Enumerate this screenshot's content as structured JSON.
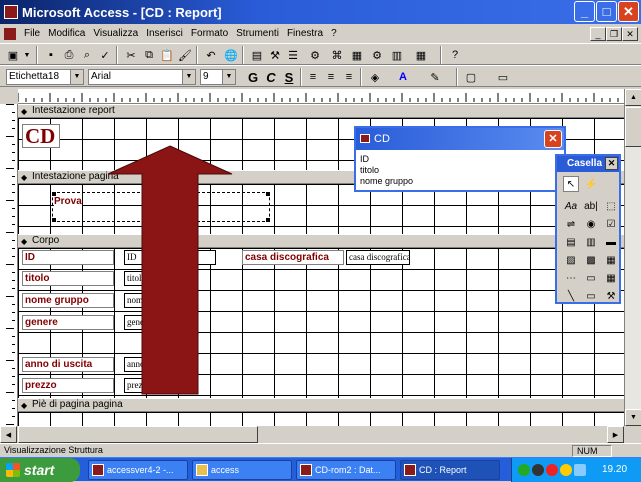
{
  "window": {
    "title": "Microsoft Access - [CD : Report]",
    "min": "_",
    "max": "□",
    "close": "✕"
  },
  "menu": {
    "items": [
      "File",
      "Modifica",
      "Visualizza",
      "Inserisci",
      "Formato",
      "Strumenti",
      "Finestra",
      "?"
    ]
  },
  "format_toolbar": {
    "object": "Etichetta18",
    "font": "Arial",
    "size": "9",
    "bold": "G",
    "italic": "C",
    "underline": "S"
  },
  "sections": {
    "report_header": "Intestazione report",
    "page_header": "Intestazione pagina",
    "detail": "Corpo",
    "page_footer": "Piè di pagina pagina"
  },
  "report_header": {
    "title": "CD"
  },
  "page_header": {
    "label": "Prova"
  },
  "detail": {
    "rows": [
      {
        "label": "ID",
        "field": "ID"
      },
      {
        "label": "titolo",
        "field": "titolo"
      },
      {
        "label": "nome gruppo",
        "field": "nome gruppo"
      },
      {
        "label": "genere",
        "field": "genere"
      },
      {
        "label": "anno di uscita",
        "field": "anno di uscita"
      },
      {
        "label": "prezzo",
        "field": "prezzo"
      }
    ],
    "extra": {
      "label": "casa discografica",
      "field": "casa discografica"
    }
  },
  "field_list": {
    "title": "CD",
    "items": [
      "ID",
      "titolo",
      "nome gruppo"
    ]
  },
  "toolbox": {
    "title": "Casella",
    "close": "✕"
  },
  "status": {
    "left": "Visualizzazione Struttura",
    "num": "NUM"
  },
  "taskbar": {
    "start": "start",
    "tasks": [
      "accessver4-2 -...",
      "access",
      "CD-rom2 : Dat...",
      "CD : Report"
    ],
    "clock": "19.20"
  },
  "colors": {
    "arrow": "#8b1515",
    "label_text": "#800000",
    "title_bar": "#2a5cd8"
  }
}
